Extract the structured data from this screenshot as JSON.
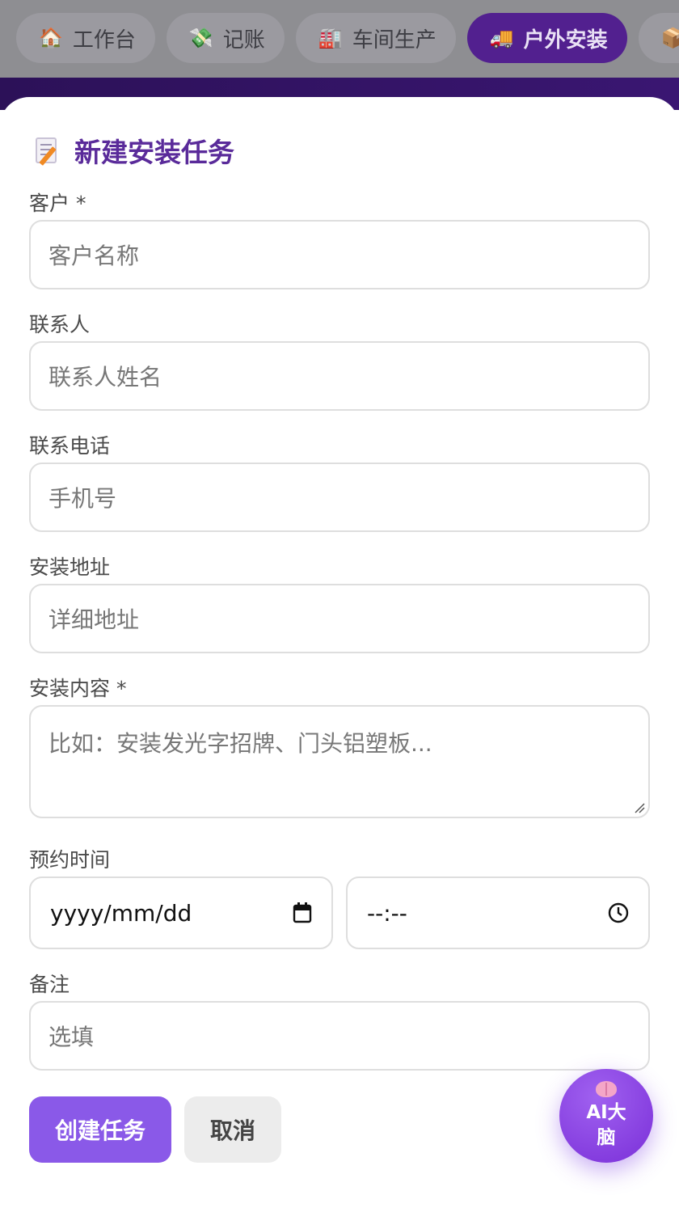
{
  "nav": {
    "tabs": [
      {
        "label": "工作台",
        "icon": "house-icon",
        "active": false
      },
      {
        "label": "记账",
        "icon": "money-icon",
        "active": false
      },
      {
        "label": "车间生产",
        "icon": "factory-icon",
        "active": false
      },
      {
        "label": "户外安装",
        "icon": "truck-icon",
        "active": true
      }
    ]
  },
  "form": {
    "title": "新建安装任务",
    "customer": {
      "label": "客户 *",
      "placeholder": "客户名称"
    },
    "contact": {
      "label": "联系人",
      "placeholder": "联系人姓名"
    },
    "phone": {
      "label": "联系电话",
      "placeholder": "手机号"
    },
    "address": {
      "label": "安装地址",
      "placeholder": "详细地址"
    },
    "content": {
      "label": "安装内容 *",
      "placeholder": "比如：安装发光字招牌、门头铝塑板..."
    },
    "schedule": {
      "label": "预约时间",
      "date_placeholder": "yyyy/mm/dd",
      "time_placeholder": "--:--"
    },
    "notes": {
      "label": "备注",
      "placeholder": "选填"
    },
    "create_label": "创建任务",
    "cancel_label": "取消"
  },
  "ai_button": {
    "label": "AI大脑"
  },
  "colors": {
    "accent": "#8a59e8",
    "title": "#5a2b9a",
    "nav_active": "#52208f"
  }
}
